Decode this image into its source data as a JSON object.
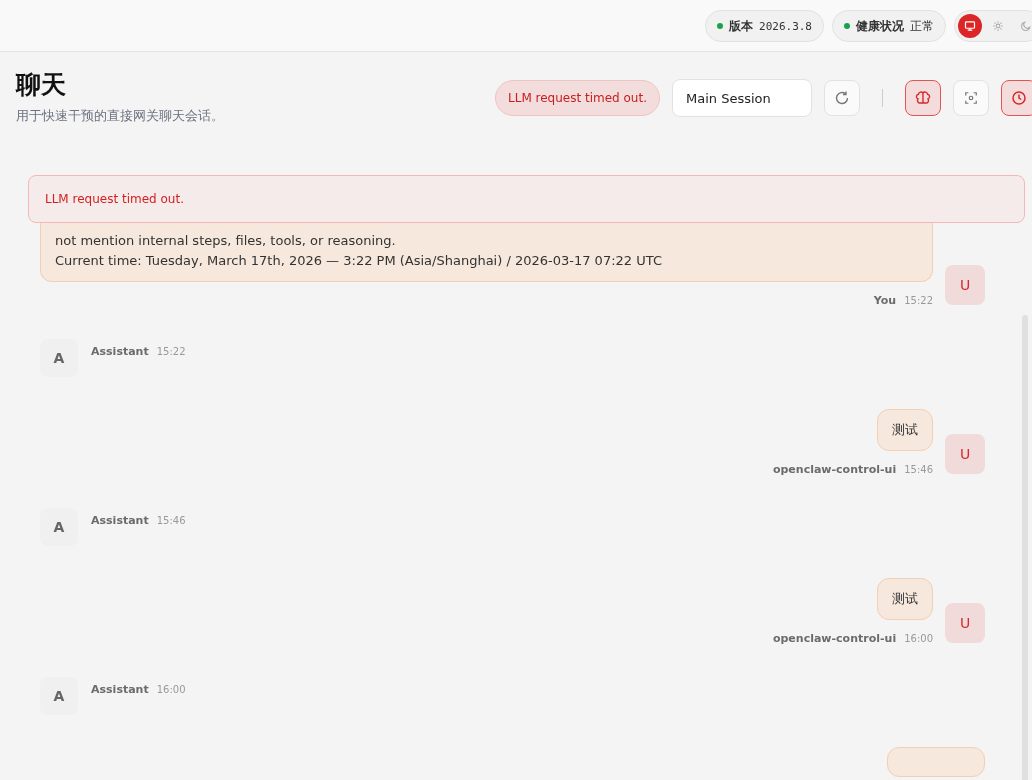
{
  "topbar": {
    "version": {
      "label": "版本",
      "value": "2026.3.8",
      "color": "#16a34a"
    },
    "health": {
      "label": "健康状况",
      "value": "正常",
      "color": "#16a34a"
    },
    "theme": [
      {
        "kind": "monitor",
        "selected": true
      },
      {
        "kind": "sun",
        "selected": false
      },
      {
        "kind": "moon",
        "selected": false
      }
    ]
  },
  "header": {
    "title": "聊天",
    "subtitle": "用于快速干预的直接网关聊天会话。",
    "error_pill": "LLM request timed out.",
    "session": {
      "value": "Main Session"
    },
    "tools": [
      {
        "kind": "refresh",
        "active": false
      },
      {
        "kind": "separator"
      },
      {
        "kind": "brain",
        "active": true
      },
      {
        "kind": "focus",
        "active": false
      },
      {
        "kind": "clock",
        "active": true
      }
    ]
  },
  "error_banner": "LLM request timed out.",
  "messages": [
    {
      "kind": "user",
      "avatar": "U",
      "lines": [
        "not mention internal steps, files, tools, or reasoning.",
        "Current time: Tuesday, March 17th, 2026 — 3:22 PM (Asia/Shanghai) / 2026-03-17 07:22 UTC"
      ],
      "sender": "You",
      "time": "15:22"
    },
    {
      "kind": "assistant",
      "avatar": "A",
      "sender": "Assistant",
      "time": "15:22"
    },
    {
      "kind": "user",
      "avatar": "U",
      "lines": [
        "测试"
      ],
      "sender": "openclaw-control-ui",
      "time": "15:46"
    },
    {
      "kind": "assistant",
      "avatar": "A",
      "sender": "Assistant",
      "time": "15:46"
    },
    {
      "kind": "user",
      "avatar": "U",
      "lines": [
        "测试"
      ],
      "sender": "openclaw-control-ui",
      "time": "16:00"
    },
    {
      "kind": "assistant",
      "avatar": "A",
      "sender": "Assistant",
      "time": "16:00"
    },
    {
      "kind": "user"
    }
  ]
}
